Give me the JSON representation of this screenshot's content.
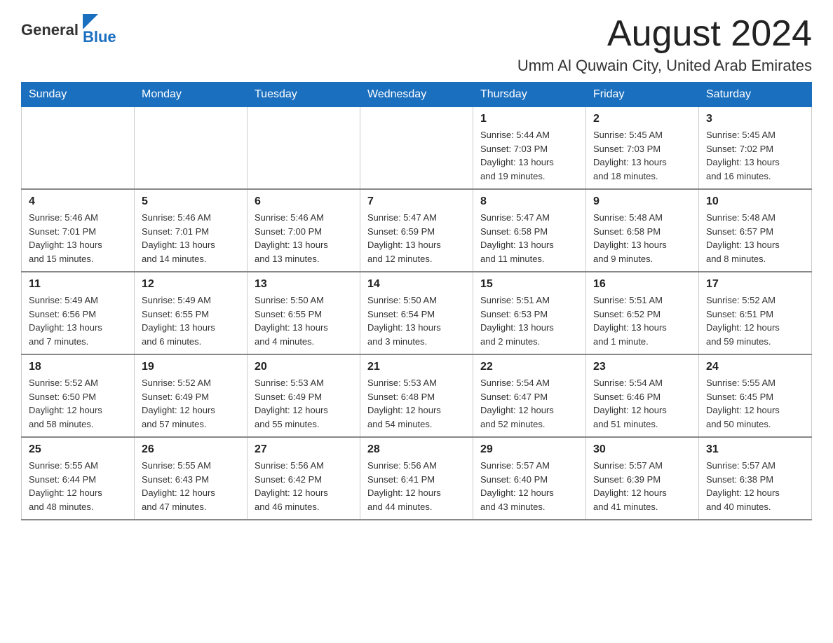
{
  "logo": {
    "text_general": "General",
    "text_blue": "Blue"
  },
  "title": {
    "month": "August 2024",
    "location": "Umm Al Quwain City, United Arab Emirates"
  },
  "weekdays": [
    "Sunday",
    "Monday",
    "Tuesday",
    "Wednesday",
    "Thursday",
    "Friday",
    "Saturday"
  ],
  "weeks": [
    [
      {
        "day": "",
        "info": ""
      },
      {
        "day": "",
        "info": ""
      },
      {
        "day": "",
        "info": ""
      },
      {
        "day": "",
        "info": ""
      },
      {
        "day": "1",
        "info": "Sunrise: 5:44 AM\nSunset: 7:03 PM\nDaylight: 13 hours\nand 19 minutes."
      },
      {
        "day": "2",
        "info": "Sunrise: 5:45 AM\nSunset: 7:03 PM\nDaylight: 13 hours\nand 18 minutes."
      },
      {
        "day": "3",
        "info": "Sunrise: 5:45 AM\nSunset: 7:02 PM\nDaylight: 13 hours\nand 16 minutes."
      }
    ],
    [
      {
        "day": "4",
        "info": "Sunrise: 5:46 AM\nSunset: 7:01 PM\nDaylight: 13 hours\nand 15 minutes."
      },
      {
        "day": "5",
        "info": "Sunrise: 5:46 AM\nSunset: 7:01 PM\nDaylight: 13 hours\nand 14 minutes."
      },
      {
        "day": "6",
        "info": "Sunrise: 5:46 AM\nSunset: 7:00 PM\nDaylight: 13 hours\nand 13 minutes."
      },
      {
        "day": "7",
        "info": "Sunrise: 5:47 AM\nSunset: 6:59 PM\nDaylight: 13 hours\nand 12 minutes."
      },
      {
        "day": "8",
        "info": "Sunrise: 5:47 AM\nSunset: 6:58 PM\nDaylight: 13 hours\nand 11 minutes."
      },
      {
        "day": "9",
        "info": "Sunrise: 5:48 AM\nSunset: 6:58 PM\nDaylight: 13 hours\nand 9 minutes."
      },
      {
        "day": "10",
        "info": "Sunrise: 5:48 AM\nSunset: 6:57 PM\nDaylight: 13 hours\nand 8 minutes."
      }
    ],
    [
      {
        "day": "11",
        "info": "Sunrise: 5:49 AM\nSunset: 6:56 PM\nDaylight: 13 hours\nand 7 minutes."
      },
      {
        "day": "12",
        "info": "Sunrise: 5:49 AM\nSunset: 6:55 PM\nDaylight: 13 hours\nand 6 minutes."
      },
      {
        "day": "13",
        "info": "Sunrise: 5:50 AM\nSunset: 6:55 PM\nDaylight: 13 hours\nand 4 minutes."
      },
      {
        "day": "14",
        "info": "Sunrise: 5:50 AM\nSunset: 6:54 PM\nDaylight: 13 hours\nand 3 minutes."
      },
      {
        "day": "15",
        "info": "Sunrise: 5:51 AM\nSunset: 6:53 PM\nDaylight: 13 hours\nand 2 minutes."
      },
      {
        "day": "16",
        "info": "Sunrise: 5:51 AM\nSunset: 6:52 PM\nDaylight: 13 hours\nand 1 minute."
      },
      {
        "day": "17",
        "info": "Sunrise: 5:52 AM\nSunset: 6:51 PM\nDaylight: 12 hours\nand 59 minutes."
      }
    ],
    [
      {
        "day": "18",
        "info": "Sunrise: 5:52 AM\nSunset: 6:50 PM\nDaylight: 12 hours\nand 58 minutes."
      },
      {
        "day": "19",
        "info": "Sunrise: 5:52 AM\nSunset: 6:49 PM\nDaylight: 12 hours\nand 57 minutes."
      },
      {
        "day": "20",
        "info": "Sunrise: 5:53 AM\nSunset: 6:49 PM\nDaylight: 12 hours\nand 55 minutes."
      },
      {
        "day": "21",
        "info": "Sunrise: 5:53 AM\nSunset: 6:48 PM\nDaylight: 12 hours\nand 54 minutes."
      },
      {
        "day": "22",
        "info": "Sunrise: 5:54 AM\nSunset: 6:47 PM\nDaylight: 12 hours\nand 52 minutes."
      },
      {
        "day": "23",
        "info": "Sunrise: 5:54 AM\nSunset: 6:46 PM\nDaylight: 12 hours\nand 51 minutes."
      },
      {
        "day": "24",
        "info": "Sunrise: 5:55 AM\nSunset: 6:45 PM\nDaylight: 12 hours\nand 50 minutes."
      }
    ],
    [
      {
        "day": "25",
        "info": "Sunrise: 5:55 AM\nSunset: 6:44 PM\nDaylight: 12 hours\nand 48 minutes."
      },
      {
        "day": "26",
        "info": "Sunrise: 5:55 AM\nSunset: 6:43 PM\nDaylight: 12 hours\nand 47 minutes."
      },
      {
        "day": "27",
        "info": "Sunrise: 5:56 AM\nSunset: 6:42 PM\nDaylight: 12 hours\nand 46 minutes."
      },
      {
        "day": "28",
        "info": "Sunrise: 5:56 AM\nSunset: 6:41 PM\nDaylight: 12 hours\nand 44 minutes."
      },
      {
        "day": "29",
        "info": "Sunrise: 5:57 AM\nSunset: 6:40 PM\nDaylight: 12 hours\nand 43 minutes."
      },
      {
        "day": "30",
        "info": "Sunrise: 5:57 AM\nSunset: 6:39 PM\nDaylight: 12 hours\nand 41 minutes."
      },
      {
        "day": "31",
        "info": "Sunrise: 5:57 AM\nSunset: 6:38 PM\nDaylight: 12 hours\nand 40 minutes."
      }
    ]
  ]
}
